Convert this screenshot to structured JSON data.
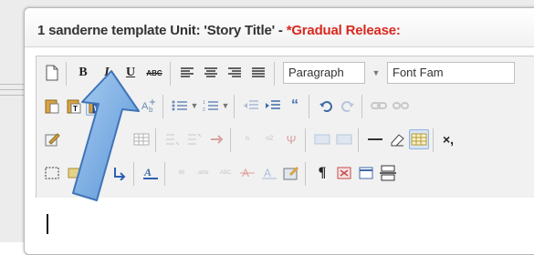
{
  "editor": {
    "title_prefix": "1 sanderne template Unit: 'Story Title' - ",
    "title_alert": "*Gradual Release:"
  },
  "toolbar": {
    "bold_label": "B",
    "italic_label": "I",
    "underline_label": "U",
    "strike_label": "ABC",
    "format_select_value": "Paragraph",
    "font_select_value": "Font Fam",
    "pilcrow_label": "¶",
    "cut_label": "×,"
  },
  "icons": {
    "row1": [
      "new-document-icon",
      "bold-icon",
      "italic-icon",
      "underline-icon",
      "strikethrough-icon",
      "align-left-icon",
      "align-center-icon",
      "align-right-icon",
      "justify-icon"
    ],
    "row2": [
      "paste-icon",
      "paste-text-icon",
      "paste-word-icon",
      "find-icon",
      "replace-icon",
      "bullet-list-icon",
      "numbered-list-icon",
      "outdent-icon",
      "indent-icon",
      "blockquote-icon",
      "undo-icon",
      "redo-icon",
      "link-icon",
      "unlink-icon"
    ],
    "row3": [
      "cleanup-icon",
      "table-icon",
      "subscript-icon",
      "superscript-icon",
      "special-char-icon",
      "horizontal-rule-icon",
      "remove-format-icon",
      "visual-aid-icon"
    ],
    "row4": [
      "select-all-icon",
      "anchor-icon",
      "text-color-icon",
      "cite-icon",
      "abbr-icon",
      "acronym-icon",
      "delete-icon",
      "insert-icon",
      "attribs-icon",
      "pilcrow-icon",
      "nonbreaking-icon",
      "template-icon",
      "pagebreak-icon"
    ]
  },
  "colors": {
    "alert": "#d9281f",
    "highlight": "#d6e4f5",
    "pointer_arrow": "#7fb2e5"
  }
}
